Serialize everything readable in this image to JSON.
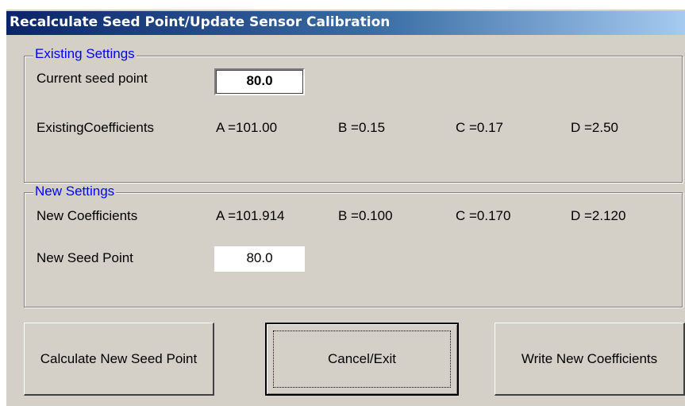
{
  "window": {
    "title": "Recalculate Seed Point/Update Sensor Calibration"
  },
  "existing": {
    "legend": "Existing Settings",
    "seed_label": "Current seed point",
    "seed_value": "80.0",
    "coeff_label": "ExistingCoefficients",
    "a": "A =101.00",
    "b": "B =0.15",
    "c": "C =0.17",
    "d": "D =2.50"
  },
  "new": {
    "legend": "New Settings",
    "coeff_label": "New Coefficients",
    "a": "A =101.914",
    "b": "B =0.100",
    "c": "C =0.170",
    "d": "D =2.120",
    "seed_label": "New Seed Point",
    "seed_value": "80.0"
  },
  "buttons": {
    "calculate": "Calculate New Seed Point",
    "cancel": "Cancel/Exit",
    "write": "Write New Coefficients"
  }
}
